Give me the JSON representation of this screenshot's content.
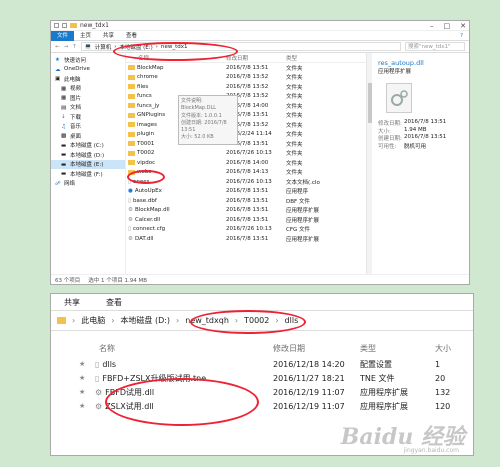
{
  "top_window": {
    "title": "new_tdx1",
    "ribbon_tabs": [
      "文件",
      "主页",
      "共享",
      "查看"
    ],
    "breadcrumb": [
      "计算机",
      "本地磁盘 (E:)",
      "new_tdx1"
    ],
    "search_placeholder": "搜索\"new_tdx1\"",
    "nav": [
      {
        "label": "快速访问",
        "level": 0
      },
      {
        "label": "OneDrive",
        "level": 0
      },
      {
        "label": "此电脑",
        "level": 0
      },
      {
        "label": "视频",
        "level": 1
      },
      {
        "label": "图片",
        "level": 1
      },
      {
        "label": "文档",
        "level": 1
      },
      {
        "label": "下载",
        "level": 1
      },
      {
        "label": "音乐",
        "level": 1
      },
      {
        "label": "桌面",
        "level": 1
      },
      {
        "label": "本地磁盘 (C:)",
        "level": 1
      },
      {
        "label": "本地磁盘 (D:)",
        "level": 1
      },
      {
        "label": "本地磁盘 (E:)",
        "level": 1,
        "selected": true
      },
      {
        "label": "本地磁盘 (F:)",
        "level": 1
      },
      {
        "label": "网络",
        "level": 0
      }
    ],
    "columns": [
      "名称",
      "修改日期",
      "类型"
    ],
    "files": [
      {
        "name": "BlockMap",
        "date": "2016/7/8 13:51",
        "type": "文件夹",
        "icon": "folder"
      },
      {
        "name": "chrome",
        "date": "2016/7/8 13:52",
        "type": "文件夹",
        "icon": "folder"
      },
      {
        "name": "files",
        "date": "2016/7/8 13:52",
        "type": "文件夹",
        "icon": "folder"
      },
      {
        "name": "funcs",
        "date": "2016/7/8 13:52",
        "type": "文件夹",
        "icon": "folder"
      },
      {
        "name": "funcs_jy",
        "date": "2016/7/8 14:00",
        "type": "文件夹",
        "icon": "folder"
      },
      {
        "name": "GNPlugins",
        "date": "2016/7/8 13:51",
        "type": "文件夹",
        "icon": "folder"
      },
      {
        "name": "images",
        "date": "2016/7/8 13:52",
        "type": "文件夹",
        "icon": "folder"
      },
      {
        "name": "plugin",
        "date": "2016/2/24 11:14",
        "type": "文件夹",
        "icon": "folder"
      },
      {
        "name": "T0001",
        "date": "2016/7/8 13:51",
        "type": "文件夹",
        "icon": "folder"
      },
      {
        "name": "T0002",
        "date": "2016/7/26 10:13",
        "type": "文件夹",
        "icon": "folder"
      },
      {
        "name": "vipdoc",
        "date": "2016/7/8 14:00",
        "type": "文件夹",
        "icon": "folder"
      },
      {
        "name": "webs",
        "date": "2016/7/8 14:13",
        "type": "文件夹",
        "icon": "folder"
      },
      {
        "name": "anees",
        "date": "2016/7/26 10:13",
        "type": "文本文档(.clo",
        "icon": "file"
      },
      {
        "name": "AutoUpEx",
        "date": "2016/7/8 13:51",
        "type": "应用程序",
        "icon": "app"
      },
      {
        "name": "base.dbf",
        "date": "2016/7/8 13:51",
        "type": "DBF 文件",
        "icon": "file"
      },
      {
        "name": "BlockMap.dll",
        "date": "2016/7/8 13:51",
        "type": "应用程序扩展",
        "icon": "dll"
      },
      {
        "name": "Calcer.dll",
        "date": "2016/7/8 13:51",
        "type": "应用程序扩展",
        "icon": "dll"
      },
      {
        "name": "connect.cfg",
        "date": "2016/7/26 10:13",
        "type": "CFG 文件",
        "icon": "file"
      },
      {
        "name": "DAT.dll",
        "date": "2016/7/8 13:51",
        "type": "应用程序扩展",
        "icon": "dll"
      }
    ],
    "tooltip": [
      "文件说明: BlockMap.DLL",
      "文件版本: 1.0.0.1",
      "创建日期: 2016/7/8 13:51",
      "大小: 52.0 KB"
    ],
    "preview": {
      "name": "res_autoup.dll",
      "type": "应用程序扩展",
      "rows": [
        {
          "k": "修改日期:",
          "v": "2016/7/8 13:51"
        },
        {
          "k": "大小:",
          "v": "1.94 MB"
        },
        {
          "k": "创建日期:",
          "v": "2016/7/8 13:51"
        },
        {
          "k": "可用性:",
          "v": "脱机可用"
        }
      ]
    },
    "status": [
      "63 个项目",
      "选中 1 个项目 1.94 MB"
    ]
  },
  "bottom_window": {
    "ribbon_tabs": [
      "共享",
      "查看"
    ],
    "breadcrumb": [
      "此电脑",
      "本地磁盘 (D:)",
      "new_tdxqh",
      "T0002",
      "dlls"
    ],
    "columns": [
      "名称",
      "修改日期",
      "类型",
      "大小"
    ],
    "files": [
      {
        "name": "dlls",
        "date": "2016/12/18 14:20",
        "type": "配置设置",
        "size": "1",
        "icon": "file"
      },
      {
        "name": "FBFD+ZSLX升级版试用.tne",
        "date": "2016/11/27 18:21",
        "type": "TNE 文件",
        "size": "20",
        "icon": "file"
      },
      {
        "name": "FBFD试用.dll",
        "date": "2016/12/19 11:07",
        "type": "应用程序扩展",
        "size": "132",
        "icon": "dll"
      },
      {
        "name": "ZSLX试用.dll",
        "date": "2016/12/19 11:07",
        "type": "应用程序扩展",
        "size": "120",
        "icon": "dll"
      }
    ],
    "watermark": "Baidu 经验",
    "watermark_sub": "jingyan.baidu.com"
  },
  "colors": {
    "accent": "#1979ca",
    "folder": "#f3c24c",
    "annotation": "#e22233",
    "selection": "#cce4f7"
  }
}
